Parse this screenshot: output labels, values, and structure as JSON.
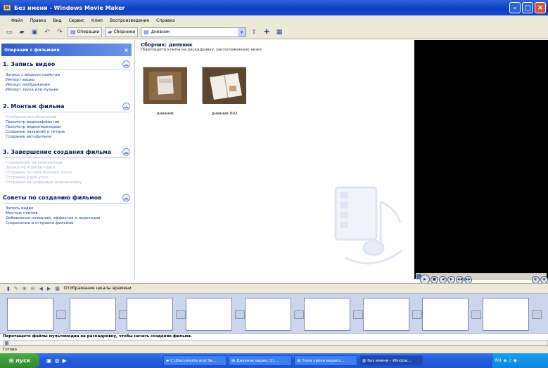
{
  "window": {
    "title": "Без имени - Windows Movie Maker"
  },
  "menu": [
    "Файл",
    "Правка",
    "Вид",
    "Сервис",
    "Клип",
    "Воспроизведение",
    "Справка"
  ],
  "toolbar": {
    "tasks_label": "Операции",
    "collections_label": "Сборники",
    "collection_value": "дневник"
  },
  "tasks_pane": {
    "header": "Операции с фильмами",
    "sections": [
      {
        "title": "1. Запись видео",
        "links": [
          {
            "text": "Запись с видеоустройства",
            "enabled": true
          },
          {
            "text": "Импорт видео",
            "enabled": true
          },
          {
            "text": "Импорт изображений",
            "enabled": true
          },
          {
            "text": "Импорт звука или музыки",
            "enabled": true
          }
        ]
      },
      {
        "title": "2. Монтаж фильма",
        "links": [
          {
            "text": "Отображение сборников",
            "enabled": false
          },
          {
            "text": "Просмотр видеоэффектов",
            "enabled": true
          },
          {
            "text": "Просмотр видеопереходов",
            "enabled": true
          },
          {
            "text": "Создание названий и титров",
            "enabled": true
          },
          {
            "text": "Создание автофильма",
            "enabled": true
          }
        ]
      },
      {
        "title": "3. Завершение создания фильма",
        "links": [
          {
            "text": "Сохранение на компьютере",
            "enabled": false
          },
          {
            "text": "Запись на компакт-диск",
            "enabled": false
          },
          {
            "text": "Отправка по электронной почте",
            "enabled": false
          },
          {
            "text": "Отправка в веб-узел",
            "enabled": false
          },
          {
            "text": "Отправка на цифровую видеокамеру",
            "enabled": false
          }
        ]
      },
      {
        "title": "Советы по созданию фильмов",
        "links": [
          {
            "text": "Запись видео",
            "enabled": true
          },
          {
            "text": "Монтаж клипов",
            "enabled": true
          },
          {
            "text": "Добавление названий, эффектов и переходов",
            "enabled": true
          },
          {
            "text": "Сохранение и отправка фильмов",
            "enabled": true
          }
        ]
      }
    ]
  },
  "collection": {
    "title": "Сборник: дневник",
    "subtitle": "Перетащите клипы на раскадровку, расположенную ниже",
    "clips": [
      "дневник",
      "дневник 002"
    ]
  },
  "storyboard": {
    "toggle_label": "Отображение шкалы времени",
    "hint": "Перетащите файлы мультимедиа на раскадровку, чтобы начать создание фильма."
  },
  "status": {
    "text": "Готово"
  },
  "taskbar": {
    "start_label": "пуск",
    "tasks": [
      "C:\\Documents and Se...",
      "Дневник видео (2)...",
      "Тема урока видеоз...",
      "Без имени - Window..."
    ],
    "tray_lang": "RU"
  }
}
